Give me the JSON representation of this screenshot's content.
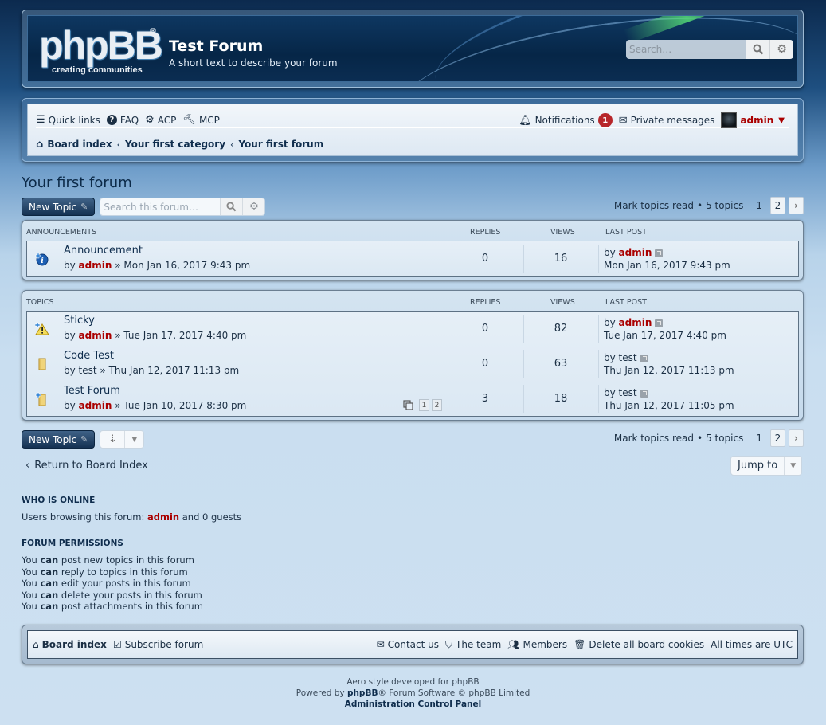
{
  "header": {
    "logo_text": "phpBB",
    "logo_registered": "®",
    "logo_tagline": "creating communities",
    "site_title": "Test Forum",
    "site_description": "A short text to describe your forum",
    "search_placeholder": "Search…",
    "search_icon": "search-icon",
    "advanced_search_icon": "gear-icon"
  },
  "navbar": {
    "quick_links": "Quick links",
    "faq": "FAQ",
    "acp": "ACP",
    "mcp": "MCP",
    "notifications": "Notifications",
    "notifications_count": "1",
    "private_messages": "Private messages",
    "username": "admin",
    "breadcrumbs": [
      "Board index",
      "Your first category",
      "Your first forum"
    ]
  },
  "page": {
    "title": "Your first forum",
    "new_topic": "New Topic",
    "forum_search_placeholder": "Search this forum…",
    "mark_read": "Mark topics read",
    "topic_count": "5 topics",
    "bullet": "•",
    "pagination": {
      "current": "1",
      "next_page": "2"
    }
  },
  "announcements": {
    "heading": "ANNOUNCEMENTS",
    "col_replies": "REPLIES",
    "col_views": "VIEWS",
    "col_last_post": "LAST POST",
    "rows": [
      {
        "title": "Announcement",
        "by": "by",
        "author": "admin",
        "date": "» Mon Jan 16, 2017 9:43 pm",
        "replies": "0",
        "views": "16",
        "last_by": "admin",
        "last_by_highlight": true,
        "last_date": "Mon Jan 16, 2017 9:43 pm",
        "icon": "announcement-icon"
      }
    ]
  },
  "topics": {
    "heading": "TOPICS",
    "col_replies": "REPLIES",
    "col_views": "VIEWS",
    "col_last_post": "LAST POST",
    "rows": [
      {
        "title": "Sticky",
        "by": "by",
        "author": "admin",
        "date": "» Tue Jan 17, 2017 4:40 pm",
        "replies": "0",
        "views": "82",
        "last_by": "admin",
        "last_date": "Tue Jan 17, 2017 4:40 pm",
        "icon": "sticky-icon"
      },
      {
        "title": "Code Test",
        "by": "by",
        "author": "test",
        "date": "» Thu Jan 12, 2017 11:13 pm",
        "replies": "0",
        "views": "63",
        "last_by": "test",
        "last_date": "Thu Jan 12, 2017 11:13 pm",
        "icon": "topic-read-icon"
      },
      {
        "title": "Test Forum",
        "by": "by",
        "author": "admin",
        "date": "» Tue Jan 10, 2017 8:30 pm",
        "replies": "3",
        "views": "18",
        "last_by": "test",
        "last_date": "Thu Jan 12, 2017 11:05 pm",
        "icon": "topic-mine-icon",
        "pages": [
          "1",
          "2"
        ]
      }
    ]
  },
  "bottom": {
    "return_link": "Return to Board Index",
    "jump_to": "Jump to"
  },
  "who_is_online": {
    "heading": "WHO IS ONLINE",
    "prefix": "Users browsing this forum: ",
    "user": "admin",
    "suffix": " and 0 guests"
  },
  "permissions": {
    "heading": "FORUM PERMISSIONS",
    "lines": [
      {
        "pre": "You ",
        "can": "can",
        "post": " post new topics in this forum"
      },
      {
        "pre": "You ",
        "can": "can",
        "post": " reply to topics in this forum"
      },
      {
        "pre": "You ",
        "can": "can",
        "post": " edit your posts in this forum"
      },
      {
        "pre": "You ",
        "can": "can",
        "post": " delete your posts in this forum"
      },
      {
        "pre": "You ",
        "can": "can",
        "post": " post attachments in this forum"
      }
    ]
  },
  "footer": {
    "board_index": "Board index",
    "subscribe": "Subscribe forum",
    "contact": "Contact us",
    "team": "The team",
    "members": "Members",
    "delete_cookies": "Delete all board cookies",
    "timezone": "All times are UTC"
  },
  "credits": {
    "line1_a": "Aero",
    "line1_b": " style developed for phpBB",
    "line2_a": "Powered by ",
    "line2_b": "phpBB",
    "line2_c": "® Forum Software © phpBB Limited",
    "acp": "Administration Control Panel"
  },
  "colors": {
    "user_red": "#aa0000",
    "link_dark": "#0f2d4d",
    "badge_red": "#b7262a"
  }
}
